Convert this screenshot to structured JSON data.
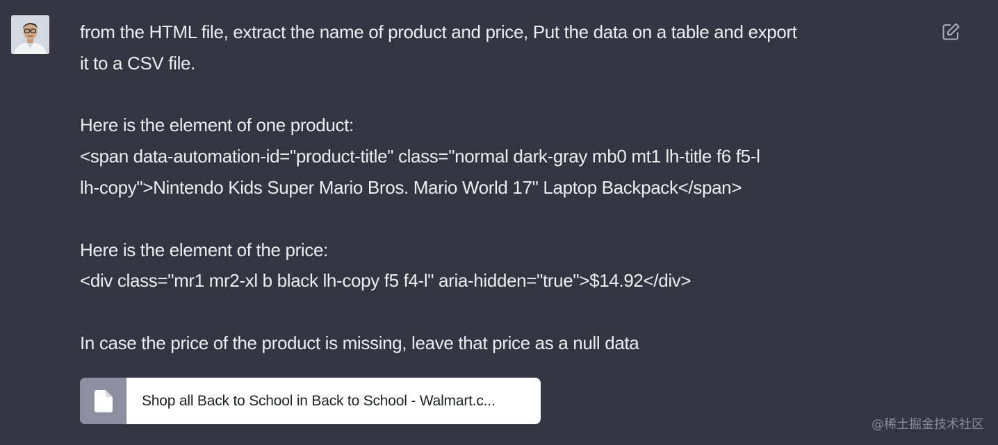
{
  "message": {
    "lines": [
      "from the HTML file, extract the name of product and price, Put the data on a table and export",
      "it to a CSV file.",
      "Here is the element of one product:",
      "<span data-automation-id=\"product-title\" class=\"normal dark-gray mb0 mt1 lh-title f6 f5-l",
      "lh-copy\">Nintendo Kids Super Mario Bros. Mario World 17\" Laptop Backpack</span>",
      "Here is the element of the price:",
      "<div class=\"mr1 mr2-xl b black lh-copy f5 f4-l\" aria-hidden=\"true\">$14.92</div>",
      "In case the price of the product is missing, leave that price as a null data"
    ]
  },
  "attachment": {
    "icon": "file-icon",
    "name": "Shop all Back to School in Back to School - Walmart.c..."
  },
  "edit": {
    "icon": "edit-icon"
  },
  "avatar": {
    "icon": "user-avatar"
  },
  "watermark": "@稀土掘金技术社区",
  "colors": {
    "background": "#343541",
    "text": "#ececf1",
    "chip_bg": "#ffffff",
    "chip_icon_bg": "#8e8ea0"
  }
}
